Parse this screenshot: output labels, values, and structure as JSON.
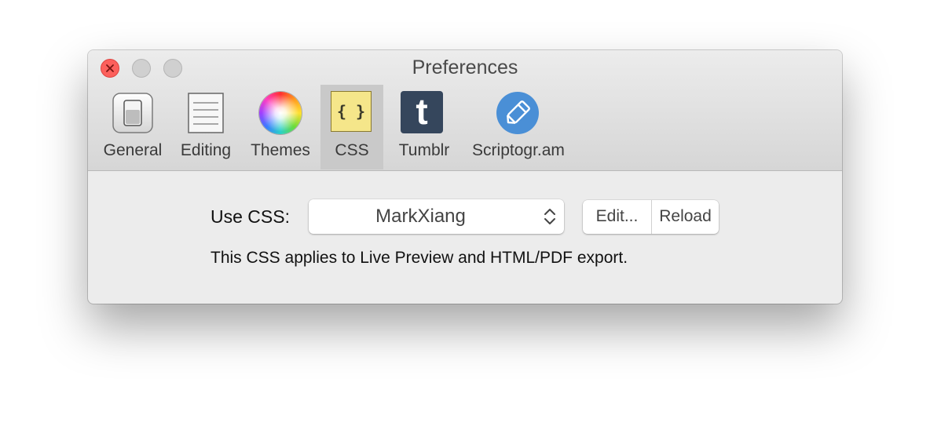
{
  "window": {
    "title": "Preferences"
  },
  "toolbar": {
    "items": [
      {
        "label": "General",
        "icon": "switch-icon",
        "selected": false
      },
      {
        "label": "Editing",
        "icon": "document-lines-icon",
        "selected": false
      },
      {
        "label": "Themes",
        "icon": "color-wheel-icon",
        "selected": false
      },
      {
        "label": "CSS",
        "icon": "curly-braces-icon",
        "selected": true
      },
      {
        "label": "Tumblr",
        "icon": "tumblr-icon",
        "selected": false
      },
      {
        "label": "Scriptogr.am",
        "icon": "scriptogram-icon",
        "selected": false
      }
    ],
    "css_glyph": "{ }",
    "tumblr_glyph": "t"
  },
  "css_panel": {
    "use_label": "Use CSS:",
    "selected_css": "MarkXiang",
    "edit_label": "Edit...",
    "reload_label": "Reload",
    "note": "This CSS applies to Live Preview and HTML/PDF export."
  },
  "colors": {
    "close": "#fc605c",
    "selected_toolbar": "#c9c9c9",
    "css_icon_bg": "#f5e68a",
    "tumblr_bg": "#35465c",
    "scriptogram_bg": "#4a8fd6"
  }
}
